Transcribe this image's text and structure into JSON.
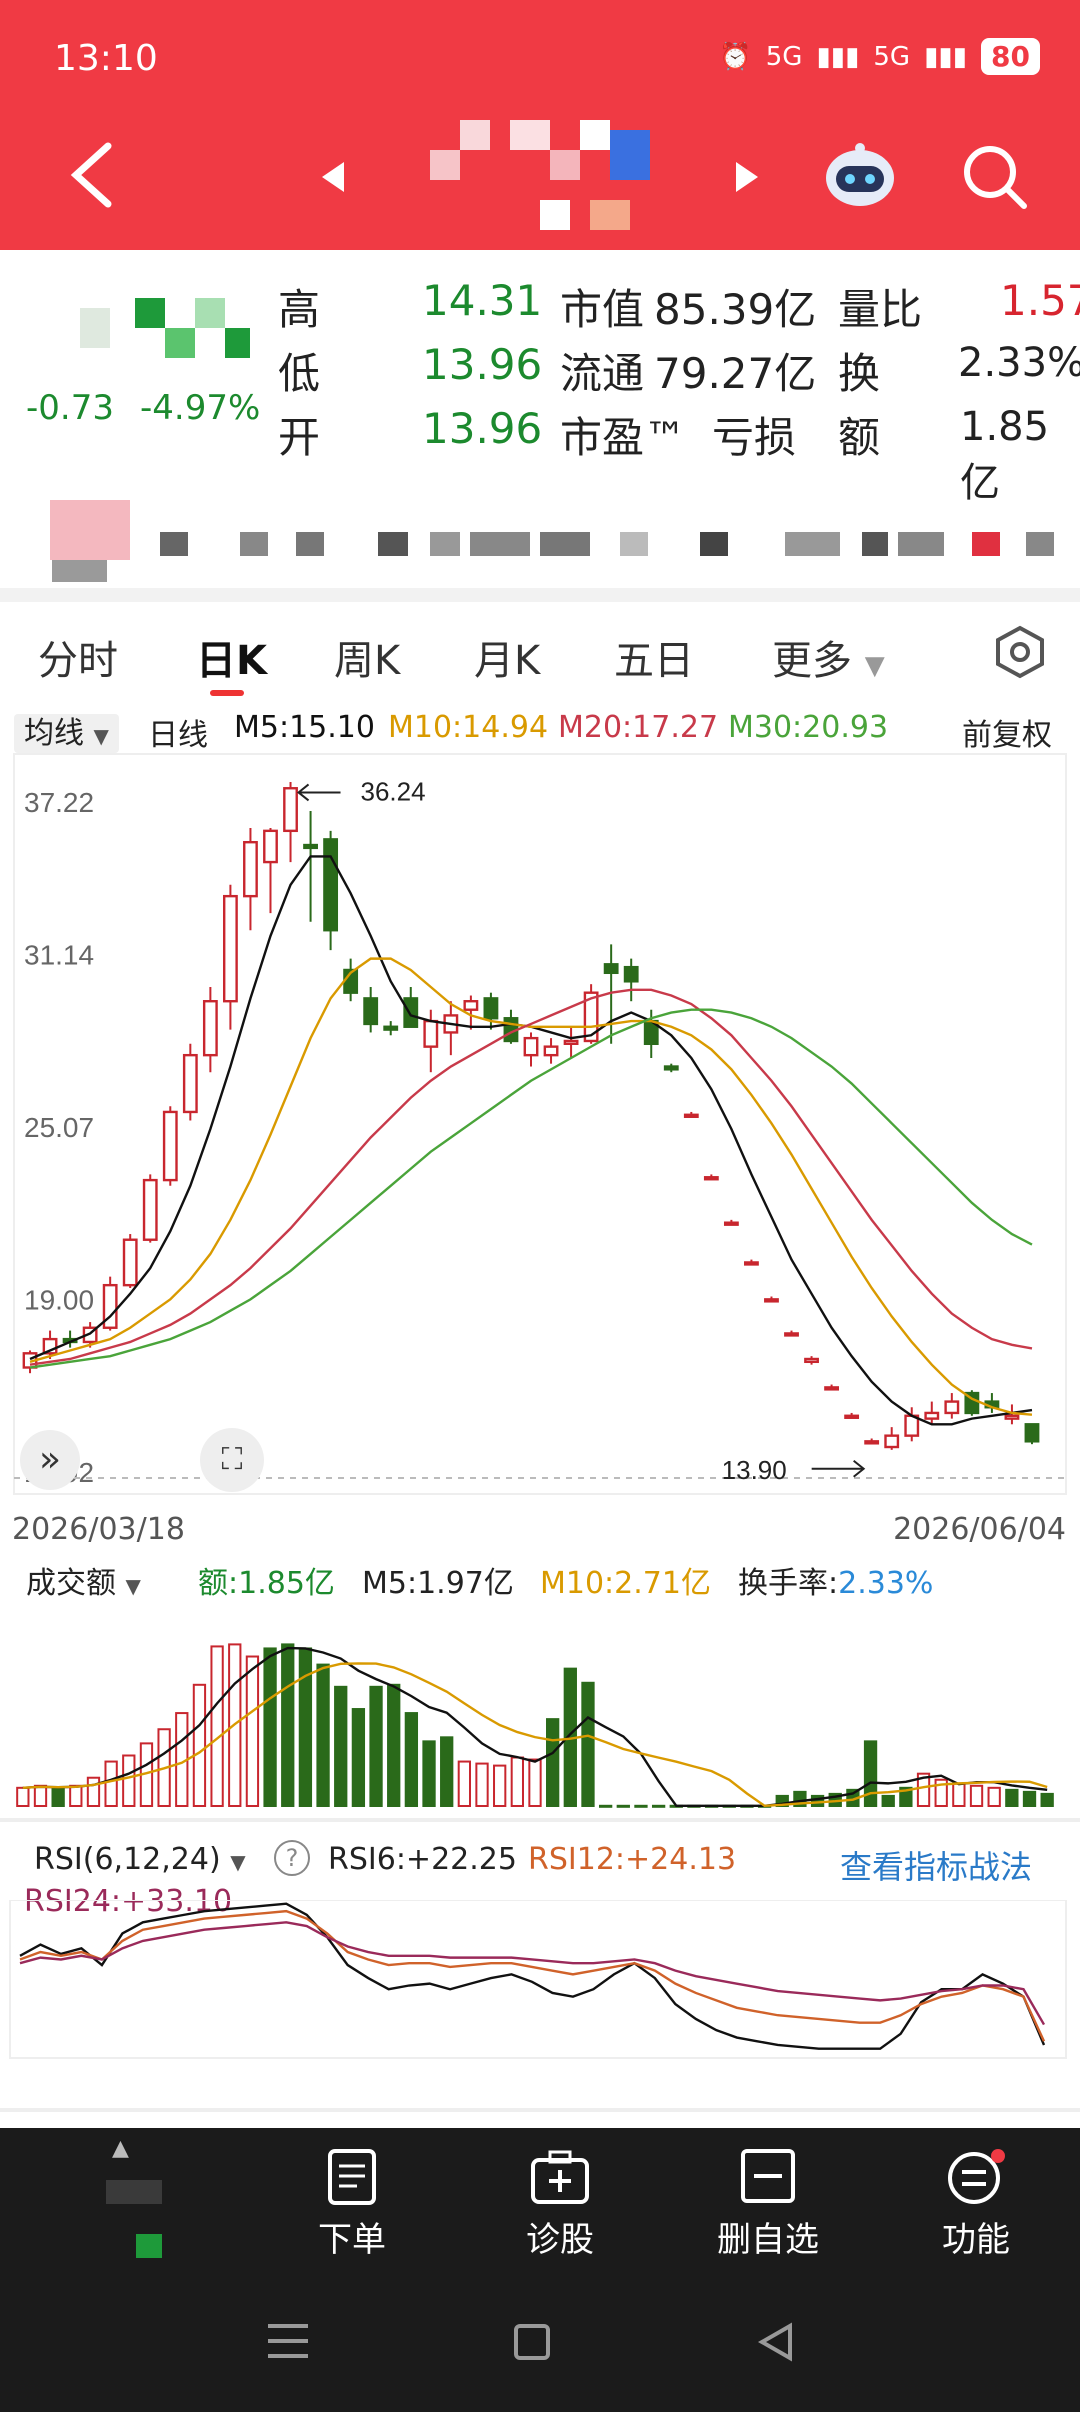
{
  "status": {
    "time": "13:10",
    "net1": "5G",
    "net2": "5G",
    "battery": "80"
  },
  "header": {
    "back_icon": "back-arrow-icon",
    "prev_icon": "prev-triangle-icon",
    "next_icon": "next-triangle-icon",
    "robot_icon": "robot-assistant-icon",
    "search_icon": "search-icon"
  },
  "quote": {
    "change": "-0.73",
    "change_pct": "-4.97%",
    "high_label": "高",
    "high": "14.31",
    "low_label": "低",
    "low": "13.96",
    "open_label": "开",
    "open": "13.96",
    "mcap_label": "市值",
    "mcap": "85.39亿",
    "float_label": "流通",
    "float": "79.27亿",
    "pe_label": "市盈™",
    "pe": "亏损",
    "vr_label": "量比",
    "vr": "1.57",
    "turnover_label": "换",
    "turnover": "2.33%",
    "amount_label": "额",
    "amount": "1.85亿"
  },
  "tabs": {
    "t1": "分时",
    "t2": "日K",
    "t3": "周K",
    "t4": "月K",
    "t5": "五日",
    "t6": "更多",
    "settings_icon": "hexagon-settings-icon"
  },
  "ma_row": {
    "selector": "均线",
    "period": "日线",
    "m5": "M5:15.10",
    "m10": "M10:14.94",
    "m20": "M20:17.27",
    "m30": "M30:20.93",
    "adj": "前复权"
  },
  "kline": {
    "y_labels": [
      "37.22",
      "31.14",
      "25.07",
      "19.00",
      "12.92"
    ],
    "hi_note": "36.24",
    "lo_note": "13.90",
    "date_start": "2026/03/18",
    "date_end": "2026/06/04"
  },
  "volume": {
    "selector": "成交额",
    "amount": "额:1.85亿",
    "m5": "M5:1.97亿",
    "m10": "M10:2.71亿",
    "turn_label": "换手率:",
    "turn": "2.33%"
  },
  "rsi": {
    "selector": "RSI(6,12,24)",
    "help": "?",
    "rsi6": "RSI6:+22.25",
    "rsi12": "RSI12:+24.13",
    "rsi24": "RSI24:+33.10",
    "link": "查看指标战法"
  },
  "bottom": {
    "b1": "下单",
    "b2": "诊股",
    "b3": "删自选",
    "b4": "功能"
  },
  "colors": {
    "header": "#f03a44",
    "up": "#c8262e",
    "down": "#2a6a1a",
    "m5": "#111111",
    "m10": "#d99a00",
    "m20": "#c83a4a",
    "m30": "#4aa43a"
  },
  "chart_data": {
    "type": "candlestick",
    "dates": {
      "start": "2026/03/18",
      "end": "2026/06/04"
    },
    "ylim": [
      12.92,
      37.22
    ],
    "candles": [
      [
        16.6,
        17.2,
        16.4,
        17.1
      ],
      [
        17.1,
        17.9,
        16.9,
        17.6
      ],
      [
        17.6,
        17.9,
        17.3,
        17.5
      ],
      [
        17.5,
        18.2,
        17.3,
        18.0
      ],
      [
        18.0,
        19.8,
        17.9,
        19.5
      ],
      [
        19.5,
        21.3,
        19.4,
        21.1
      ],
      [
        21.1,
        23.4,
        21.0,
        23.2
      ],
      [
        23.2,
        25.8,
        23.0,
        25.6
      ],
      [
        25.6,
        28.0,
        25.3,
        27.6
      ],
      [
        27.6,
        30.0,
        27.0,
        29.5
      ],
      [
        29.5,
        33.6,
        28.5,
        33.2
      ],
      [
        33.2,
        35.6,
        32.0,
        35.1
      ],
      [
        34.4,
        35.6,
        32.6,
        35.5
      ],
      [
        35.5,
        37.22,
        34.4,
        37.0
      ],
      [
        35.0,
        36.2,
        32.3,
        34.9
      ],
      [
        35.2,
        35.5,
        31.3,
        32.0
      ],
      [
        30.6,
        31.0,
        29.5,
        29.8
      ],
      [
        29.6,
        30.0,
        28.4,
        28.7
      ],
      [
        28.6,
        28.8,
        28.3,
        28.5
      ],
      [
        29.6,
        30.0,
        28.6,
        28.6
      ],
      [
        27.9,
        29.2,
        27.0,
        28.8
      ],
      [
        28.4,
        29.5,
        27.6,
        29.0
      ],
      [
        29.2,
        29.7,
        28.5,
        29.5
      ],
      [
        29.6,
        29.8,
        28.5,
        28.9
      ],
      [
        28.9,
        29.2,
        28.0,
        28.1
      ],
      [
        27.6,
        28.4,
        27.2,
        28.2
      ],
      [
        27.6,
        28.2,
        27.3,
        27.9
      ],
      [
        28.0,
        28.6,
        27.5,
        28.1
      ],
      [
        28.1,
        30.1,
        28.0,
        29.8
      ],
      [
        30.8,
        31.5,
        28.0,
        30.5
      ],
      [
        30.7,
        31.0,
        29.5,
        30.2
      ],
      [
        28.8,
        29.2,
        27.5,
        28.0
      ],
      [
        27.2,
        27.3,
        27.0,
        27.1
      ],
      [
        25.5,
        25.6,
        25.4,
        25.5
      ],
      [
        23.3,
        23.4,
        23.2,
        23.3
      ],
      [
        21.7,
        21.8,
        21.6,
        21.7
      ],
      [
        20.3,
        20.4,
        20.2,
        20.3
      ],
      [
        19.0,
        19.1,
        18.9,
        19.0
      ],
      [
        17.8,
        17.9,
        17.7,
        17.8
      ],
      [
        16.8,
        17.0,
        16.7,
        16.9
      ],
      [
        15.9,
        16.0,
        15.8,
        15.9
      ],
      [
        14.9,
        15.0,
        14.8,
        14.9
      ],
      [
        14.0,
        14.1,
        13.9,
        14.0
      ],
      [
        13.8,
        14.5,
        13.7,
        14.2
      ],
      [
        14.2,
        15.2,
        14.0,
        14.9
      ],
      [
        14.8,
        15.4,
        14.6,
        15.0
      ],
      [
        15.0,
        15.7,
        14.8,
        15.4
      ],
      [
        15.7,
        15.8,
        14.9,
        15.0
      ],
      [
        15.4,
        15.7,
        15.0,
        15.2
      ],
      [
        14.8,
        15.3,
        14.6,
        14.9
      ],
      [
        14.6,
        14.6,
        13.9,
        14.0
      ]
    ],
    "ma": {
      "M5": [
        16.9,
        17.2,
        17.5,
        17.8,
        18.4,
        19.2,
        20.1,
        21.4,
        23.0,
        25.0,
        27.2,
        29.6,
        31.8,
        33.6,
        34.6,
        34.6,
        33.3,
        31.8,
        30.2,
        29.0,
        28.8,
        28.7,
        28.6,
        28.6,
        28.7,
        28.6,
        28.4,
        28.2,
        28.3,
        28.8,
        29.1,
        28.8,
        28.3,
        27.5,
        26.4,
        25.0,
        23.4,
        21.9,
        20.4,
        19.2,
        18.0,
        17.0,
        16.1,
        15.4,
        14.9,
        14.6,
        14.6,
        14.8,
        14.9,
        15.0,
        15.1
      ],
      "M10": [
        16.8,
        17.0,
        17.2,
        17.4,
        17.6,
        18.0,
        18.5,
        19.0,
        19.7,
        20.6,
        21.8,
        23.2,
        24.8,
        26.5,
        28.2,
        29.6,
        30.5,
        31.0,
        31.0,
        30.6,
        30.0,
        29.4,
        29.0,
        28.8,
        28.7,
        28.6,
        28.6,
        28.6,
        28.6,
        28.7,
        28.8,
        28.8,
        28.6,
        28.3,
        27.8,
        27.1,
        26.2,
        25.2,
        24.1,
        22.9,
        21.7,
        20.5,
        19.4,
        18.4,
        17.5,
        16.7,
        16.0,
        15.5,
        15.2,
        15.0,
        14.94
      ],
      "M20": [
        16.7,
        16.8,
        16.9,
        17.1,
        17.3,
        17.5,
        17.8,
        18.1,
        18.5,
        19.0,
        19.5,
        20.1,
        20.8,
        21.5,
        22.3,
        23.1,
        23.9,
        24.7,
        25.4,
        26.1,
        26.7,
        27.2,
        27.6,
        28.0,
        28.4,
        28.7,
        29.0,
        29.3,
        29.6,
        29.8,
        29.9,
        29.9,
        29.7,
        29.4,
        28.9,
        28.3,
        27.5,
        26.7,
        25.8,
        24.8,
        23.8,
        22.8,
        21.8,
        20.9,
        20.0,
        19.2,
        18.5,
        18.0,
        17.6,
        17.4,
        17.27
      ],
      "M30": [
        16.6,
        16.7,
        16.8,
        16.9,
        17.0,
        17.2,
        17.4,
        17.6,
        17.9,
        18.2,
        18.6,
        19.0,
        19.5,
        20.0,
        20.6,
        21.2,
        21.8,
        22.4,
        23.0,
        23.6,
        24.2,
        24.7,
        25.2,
        25.7,
        26.2,
        26.7,
        27.1,
        27.5,
        27.9,
        28.3,
        28.6,
        28.9,
        29.1,
        29.2,
        29.2,
        29.1,
        28.9,
        28.6,
        28.2,
        27.7,
        27.2,
        26.6,
        25.9,
        25.2,
        24.5,
        23.8,
        23.1,
        22.4,
        21.8,
        21.3,
        20.93
      ]
    },
    "volume": {
      "ylim": [
        0,
        10
      ],
      "values": [
        0.9,
        1.0,
        0.9,
        1.0,
        1.4,
        2.2,
        2.5,
        3.1,
        3.8,
        4.6,
        6.0,
        7.9,
        8.0,
        7.4,
        7.8,
        8.0,
        7.8,
        7.0,
        5.9,
        4.8,
        5.9,
        6.0,
        4.6,
        3.2,
        3.4,
        2.2,
        2.1,
        2.0,
        2.4,
        2.3,
        4.3,
        6.8,
        6.1,
        0.01,
        0.01,
        0.01,
        0.01,
        0.01,
        0.01,
        0.01,
        0.01,
        0.01,
        0.01,
        0.5,
        0.7,
        0.5,
        0.6,
        0.8,
        3.2,
        0.5,
        0.9,
        1.6,
        1.3,
        1.1,
        1.0,
        0.9,
        0.8,
        0.7,
        0.6
      ],
      "up": [
        1,
        1,
        0,
        1,
        1,
        1,
        1,
        1,
        1,
        1,
        1,
        1,
        1,
        1,
        0,
        0,
        0,
        0,
        0,
        0,
        0,
        0,
        0,
        0,
        0,
        1,
        1,
        1,
        1,
        1,
        0,
        0,
        0,
        0,
        0,
        0,
        0,
        0,
        0,
        0,
        0,
        0,
        0,
        0,
        0,
        0,
        0,
        0,
        0,
        0,
        0,
        1,
        1,
        1,
        1,
        1,
        0,
        0,
        0
      ]
    },
    "rsi": {
      "rsi6": [
        70,
        76,
        71,
        74,
        65,
        82,
        88,
        90,
        92,
        94,
        95,
        96,
        97,
        98,
        92,
        80,
        65,
        58,
        52,
        54,
        55,
        52,
        55,
        58,
        60,
        56,
        50,
        48,
        52,
        60,
        66,
        58,
        44,
        36,
        30,
        26,
        24,
        22,
        21,
        20,
        20,
        20,
        20,
        28,
        45,
        52,
        52,
        60,
        55,
        48,
        22
      ],
      "rsi12": [
        68,
        72,
        70,
        72,
        68,
        78,
        84,
        86,
        88,
        90,
        91,
        92,
        93,
        94,
        90,
        82,
        72,
        68,
        65,
        66,
        66,
        64,
        65,
        66,
        66,
        64,
        62,
        60,
        62,
        64,
        66,
        62,
        55,
        50,
        46,
        42,
        40,
        38,
        37,
        36,
        35,
        34,
        34,
        38,
        44,
        48,
        50,
        54,
        52,
        48,
        24
      ],
      "rsi24": [
        66,
        69,
        68,
        70,
        68,
        74,
        78,
        80,
        82,
        84,
        85,
        86,
        87,
        88,
        86,
        80,
        75,
        72,
        70,
        70,
        70,
        69,
        69,
        69,
        69,
        68,
        67,
        66,
        66,
        67,
        68,
        66,
        62,
        59,
        57,
        55,
        53,
        51,
        50,
        49,
        48,
        47,
        46,
        47,
        49,
        51,
        52,
        54,
        54,
        52,
        33
      ]
    }
  }
}
